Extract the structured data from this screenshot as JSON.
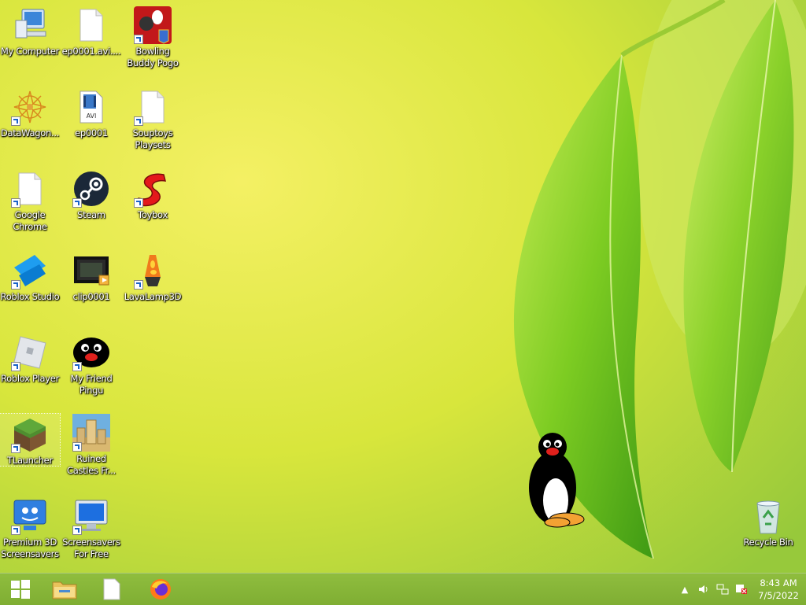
{
  "desktop": {
    "icons": [
      {
        "label": "My Computer"
      },
      {
        "label": "ep0001.avi...."
      },
      {
        "label": "Bowling Buddy Pogo"
      },
      {
        "label": "DataWagon..."
      },
      {
        "label": "ep0001"
      },
      {
        "label": "Souptoys Playsets"
      },
      {
        "label": "Google Chrome"
      },
      {
        "label": "Steam"
      },
      {
        "label": "Toybox"
      },
      {
        "label": "Roblox Studio"
      },
      {
        "label": "clip0001"
      },
      {
        "label": "LavaLamp3D"
      },
      {
        "label": "Roblox Player"
      },
      {
        "label": "My Friend Pingu"
      },
      {
        "label": "TLauncher"
      },
      {
        "label": "Ruined Castles Fr..."
      },
      {
        "label": "Premium 3D Screensavers"
      },
      {
        "label": "Screensavers For Free"
      },
      {
        "label": "Recycle Bin"
      }
    ],
    "avi_badge": "AVI"
  },
  "taskbar": {
    "pinned": [
      "start-button",
      "file-explorer",
      "notepad-document",
      "firefox"
    ],
    "tray": {
      "time": "8:43 AM",
      "date": "7/5/2022"
    }
  },
  "colors": {
    "taskbar": "#86b538",
    "wallpaper_light": "#f2ef5c",
    "leaf_green": "#6ec21e"
  }
}
